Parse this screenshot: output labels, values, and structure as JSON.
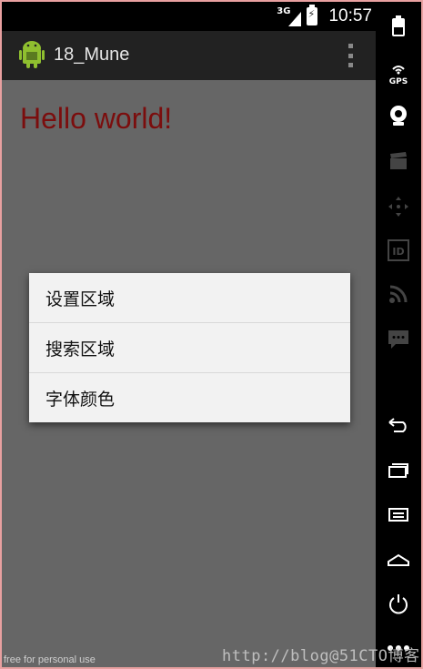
{
  "status_bar": {
    "network": "3G",
    "time": "10:57"
  },
  "action_bar": {
    "title": "18_Mune",
    "overflow_icon": "overflow-menu-icon",
    "app_icon": "android-app-icon"
  },
  "content": {
    "hello_text": "Hello world!",
    "hello_color": "#7b0d0d"
  },
  "popup_menu": {
    "items": [
      {
        "label": "设置区域"
      },
      {
        "label": "搜索区域"
      },
      {
        "label": "字体颜色"
      }
    ]
  },
  "emulator_panel": {
    "buttons": [
      {
        "icon": "power-off-icon"
      },
      {
        "icon": "gps-icon",
        "label": "GPS"
      },
      {
        "icon": "webcam-icon"
      },
      {
        "icon": "clapperboard-icon"
      },
      {
        "icon": "dpad-icon"
      },
      {
        "icon": "id-icon",
        "label": "ID"
      },
      {
        "icon": "rss-icon"
      },
      {
        "icon": "sms-icon"
      },
      {
        "icon": "back-icon"
      },
      {
        "icon": "recent-apps-icon"
      },
      {
        "icon": "menu-icon"
      },
      {
        "icon": "home-icon"
      },
      {
        "icon": "power-icon"
      },
      {
        "icon": "more-icon"
      }
    ]
  },
  "watermarks": {
    "left": "free for personal use",
    "url": "http://blog@51CTO博客"
  },
  "colors": {
    "screen_bg": "#666666",
    "action_bar_bg": "#222222",
    "popup_bg": "#f2f2f2"
  }
}
